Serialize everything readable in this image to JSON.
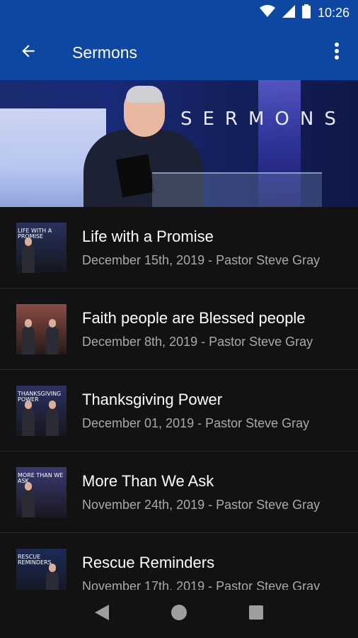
{
  "status_bar": {
    "time": "10:26",
    "icons": [
      "wifi-icon",
      "signal-icon",
      "battery-icon"
    ]
  },
  "app_bar": {
    "title": "Sermons",
    "back_icon": "arrow-back-icon",
    "overflow_icon": "more-vert-icon"
  },
  "hero": {
    "banner_text": "SERMONS"
  },
  "sermons": [
    {
      "title": "Life with a Promise",
      "subtitle": "December 15th, 2019 - Pastor Steve Gray",
      "thumb_caption": "Life with a promise",
      "thumb_color": "#27325e"
    },
    {
      "title": "Faith people are Blessed people",
      "subtitle": "December 8th, 2019 - Pastor Steve Gray",
      "thumb_caption": "",
      "thumb_color": "#8a4a44"
    },
    {
      "title": "Thanksgiving Power",
      "subtitle": "December 01, 2019 - Pastor Steve Gray",
      "thumb_caption": "Thanksgiving power",
      "thumb_color": "#2c3160"
    },
    {
      "title": "More Than We Ask",
      "subtitle": "November 24th, 2019 - Pastor Steve Gray",
      "thumb_caption": "More than we ask",
      "thumb_color": "#3a3a72"
    },
    {
      "title": "Rescue Reminders",
      "subtitle": "November 17th, 2019 - Pastor Steve Gray",
      "thumb_caption": "Rescue reminders",
      "thumb_color": "#1c2a55"
    }
  ],
  "nav_bar": {
    "icons": [
      "nav-back-icon",
      "nav-home-icon",
      "nav-recents-icon"
    ]
  }
}
